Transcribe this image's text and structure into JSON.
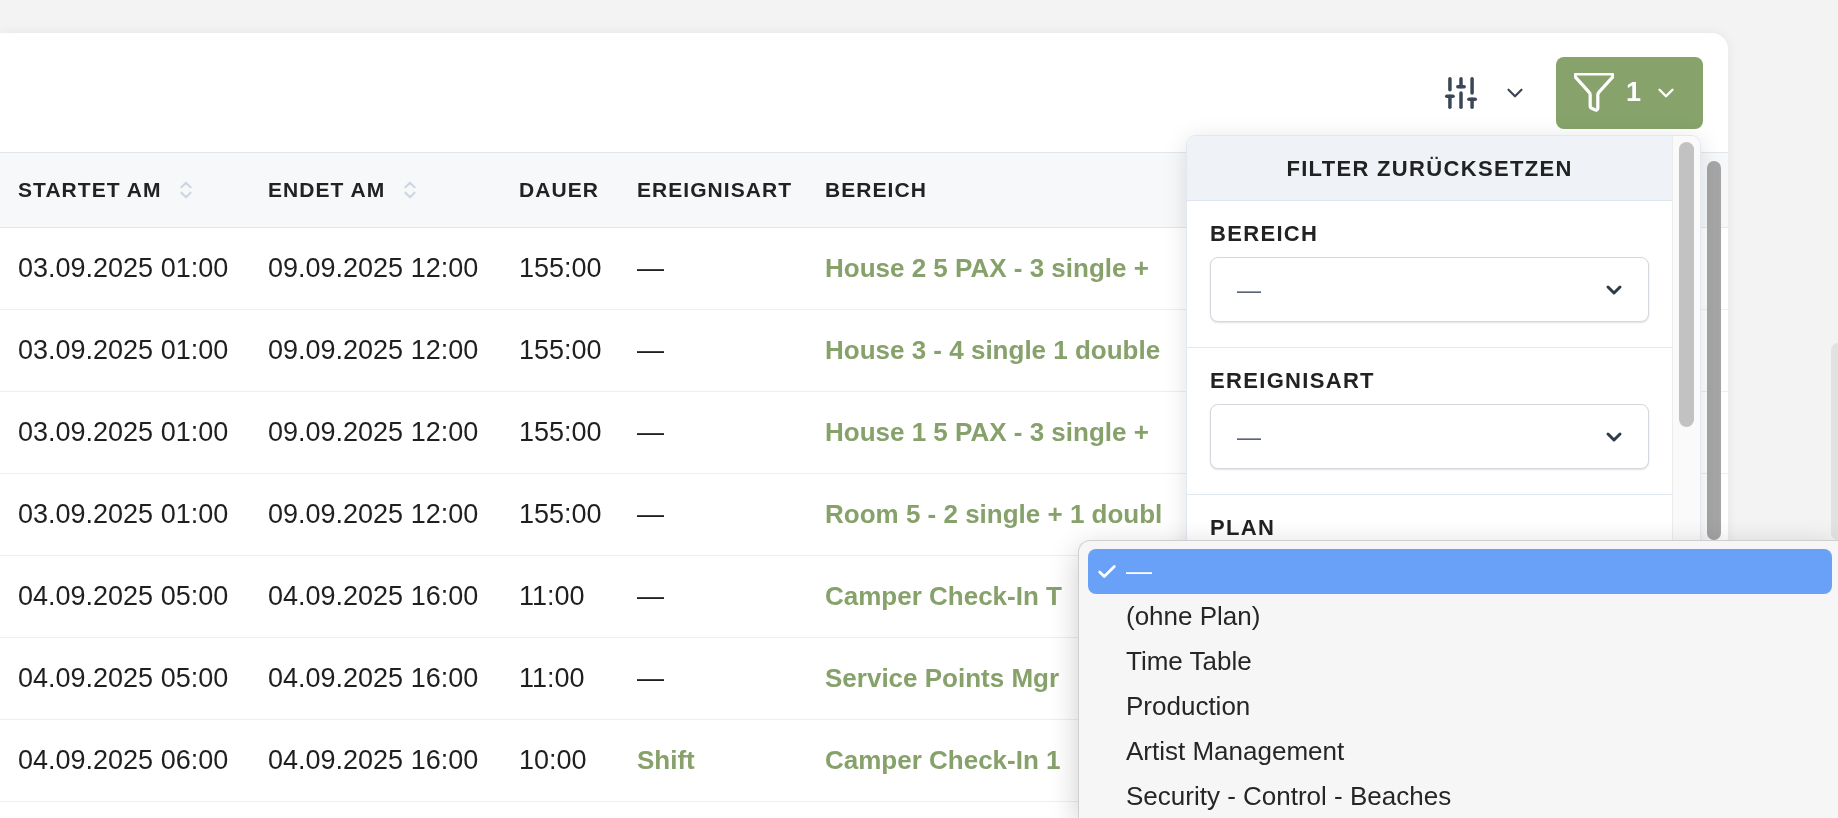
{
  "toolbar": {
    "filter_button": {
      "count": "1",
      "expanded": true
    }
  },
  "table": {
    "columns": [
      {
        "label": "STARTET AM",
        "sortable": true
      },
      {
        "label": "ENDET AM",
        "sortable": true
      },
      {
        "label": "DAUER",
        "sortable": false
      },
      {
        "label": "EREIGNISART",
        "sortable": false
      },
      {
        "label": "BEREICH",
        "sortable": false
      }
    ],
    "rows": [
      {
        "starts_at": "03.09.2025 01:00",
        "ends_at": "09.09.2025 12:00",
        "duration": "155:00",
        "event_type": {
          "text": "—",
          "kind": "plain"
        },
        "area": "House 2 5 PAX - 3 single +"
      },
      {
        "starts_at": "03.09.2025 01:00",
        "ends_at": "09.09.2025 12:00",
        "duration": "155:00",
        "event_type": {
          "text": "—",
          "kind": "plain"
        },
        "area": "House 3 - 4 single 1 double"
      },
      {
        "starts_at": "03.09.2025 01:00",
        "ends_at": "09.09.2025 12:00",
        "duration": "155:00",
        "event_type": {
          "text": "—",
          "kind": "plain"
        },
        "area": "House 1 5 PAX - 3 single +"
      },
      {
        "starts_at": "03.09.2025 01:00",
        "ends_at": "09.09.2025 12:00",
        "duration": "155:00",
        "event_type": {
          "text": "—",
          "kind": "plain"
        },
        "area": "Room 5 - 2 single + 1 doubl"
      },
      {
        "starts_at": "04.09.2025 05:00",
        "ends_at": "04.09.2025 16:00",
        "duration": "11:00",
        "event_type": {
          "text": "—",
          "kind": "plain"
        },
        "area": "Camper Check-In T"
      },
      {
        "starts_at": "04.09.2025 05:00",
        "ends_at": "04.09.2025 16:00",
        "duration": "11:00",
        "event_type": {
          "text": "—",
          "kind": "plain"
        },
        "area": "Service Points Mgr"
      },
      {
        "starts_at": "04.09.2025 06:00",
        "ends_at": "04.09.2025 16:00",
        "duration": "10:00",
        "event_type": {
          "text": "Shift",
          "kind": "link"
        },
        "area": "Camper Check-In 1"
      }
    ]
  },
  "filter_panel": {
    "reset_button": "FILTER ZURÜCKSETZEN",
    "fields": [
      {
        "label": "BEREICH",
        "value": "—"
      },
      {
        "label": "EREIGNISART",
        "value": "—"
      },
      {
        "label": "PLAN",
        "options": [
          {
            "label": "—",
            "selected": true
          },
          {
            "label": "(ohne Plan)",
            "selected": false
          },
          {
            "label": "Time Table",
            "selected": false
          },
          {
            "label": "Production",
            "selected": false
          },
          {
            "label": "Artist Management",
            "selected": false
          },
          {
            "label": "Security - Control - Beaches",
            "selected": false
          }
        ]
      }
    ]
  }
}
